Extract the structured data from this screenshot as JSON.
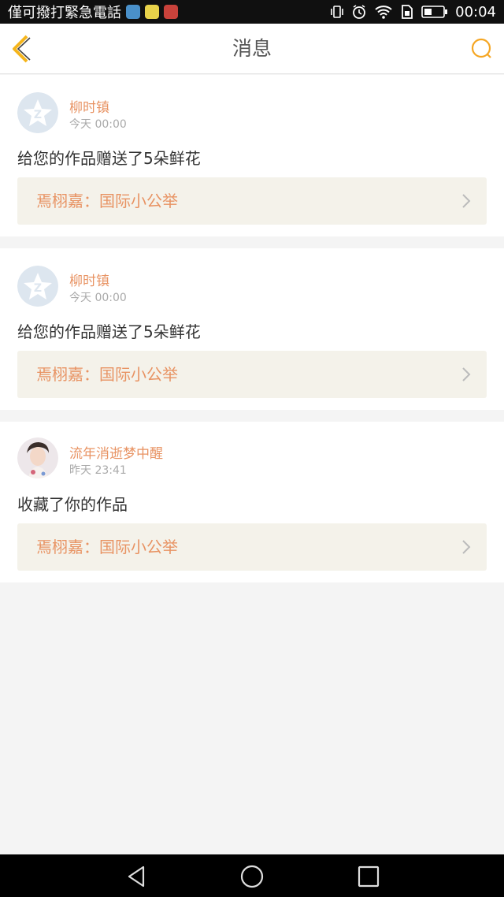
{
  "status_bar": {
    "carrier": "僅可撥打緊急電話",
    "time": "00:04",
    "app_icon_colors": [
      "#4a90c9",
      "#e8d24a",
      "#c9423b"
    ]
  },
  "header": {
    "title": "消息",
    "accent_color": "#f5a623",
    "back_icon": "chevron-left-icon",
    "search_icon": "search-icon"
  },
  "messages": [
    {
      "username": "柳时镇",
      "time": "今天 00:00",
      "text": "给您的作品赠送了5朵鲜花",
      "work_title": "焉栩嘉：国际小公举",
      "avatar": "default-avatar-icon"
    },
    {
      "username": "柳时镇",
      "time": "今天 00:00",
      "text": "给您的作品赠送了5朵鲜花",
      "work_title": "焉栩嘉：国际小公举",
      "avatar": "default-avatar-icon"
    },
    {
      "username": "流年消逝梦中醒",
      "time": "昨天 23:41",
      "text": "收藏了你的作品",
      "work_title": "焉栩嘉：国际小公举",
      "avatar": "user-photo-avatar"
    }
  ],
  "colors": {
    "name_color": "#e89363",
    "link_background": "#f4f2ea",
    "page_background": "#f4f4f4"
  }
}
